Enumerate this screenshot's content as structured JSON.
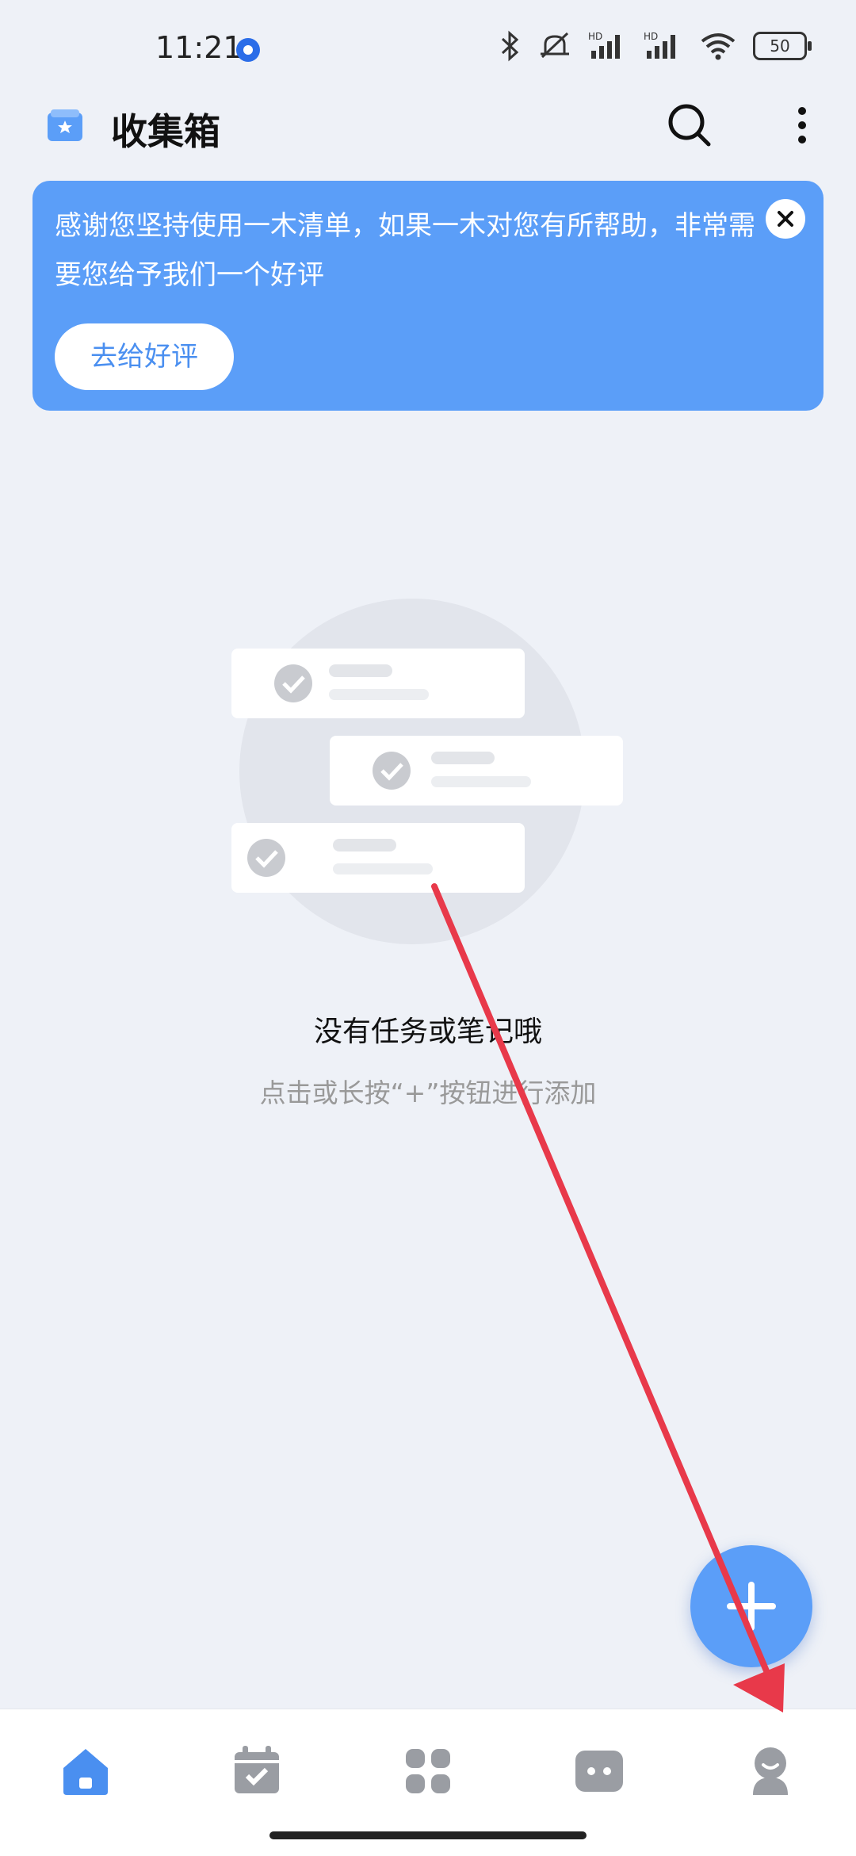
{
  "status_bar": {
    "time": "11:21",
    "battery": "50"
  },
  "header": {
    "title": "收集箱"
  },
  "banner": {
    "message": "感谢您坚持使用一木清单，如果一木对您有所帮助，非常需要您给予我们一个好评",
    "button_label": "去给好评"
  },
  "empty_state": {
    "title": "没有任务或笔记哦",
    "hint": "点击或长按“+”按钮进行添加"
  },
  "bottom_nav": {
    "items": [
      {
        "icon": "home-icon",
        "active": true
      },
      {
        "icon": "calendar-check-icon",
        "active": false
      },
      {
        "icon": "apps-grid-icon",
        "active": false
      },
      {
        "icon": "game-controller-icon",
        "active": false
      },
      {
        "icon": "profile-icon",
        "active": false
      }
    ]
  },
  "colors": {
    "accent": "#5b9ef8",
    "background": "#eef1f7",
    "nav_inactive": "#9a9da3"
  }
}
